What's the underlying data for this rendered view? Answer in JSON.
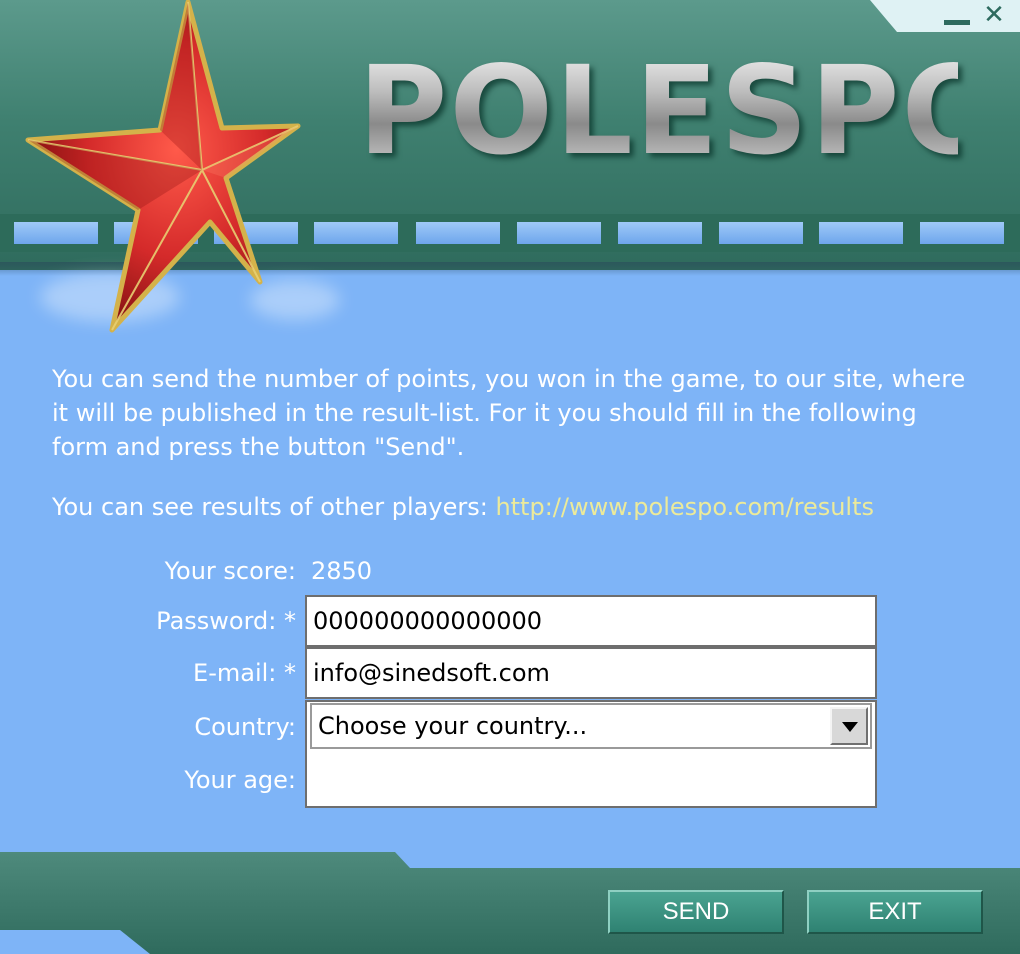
{
  "window": {
    "minimize_label": "_",
    "close_label": "✕"
  },
  "header": {
    "logo_text": "POLESPO"
  },
  "intro": {
    "paragraph": "You can send the number of points, you won in the game, to our site, where it will be published in the result-list. For it you should fill in the following form and press the button \"Send\".",
    "results_prefix": "You can see results of other players: ",
    "results_link": "http://www.polespo.com/results"
  },
  "form": {
    "score_label": "Your score:",
    "score_value": "2850",
    "password_label": "Password: *",
    "password_value": "000000000000000",
    "email_label": "E-mail: *",
    "email_value": "info@sinedsoft.com",
    "country_label": "Country:",
    "country_selected": "Choose your country...",
    "age_label": "Your age:",
    "age_value": ""
  },
  "buttons": {
    "send": "SEND",
    "exit": "EXIT"
  },
  "colors": {
    "background": "#7eb4f7",
    "header_green": "#3f8070",
    "link_yellow": "#ecea9a",
    "star_red": "#d42a2a"
  },
  "icons": {
    "logo": "red-star-icon",
    "dropdown": "chevron-down-icon"
  }
}
